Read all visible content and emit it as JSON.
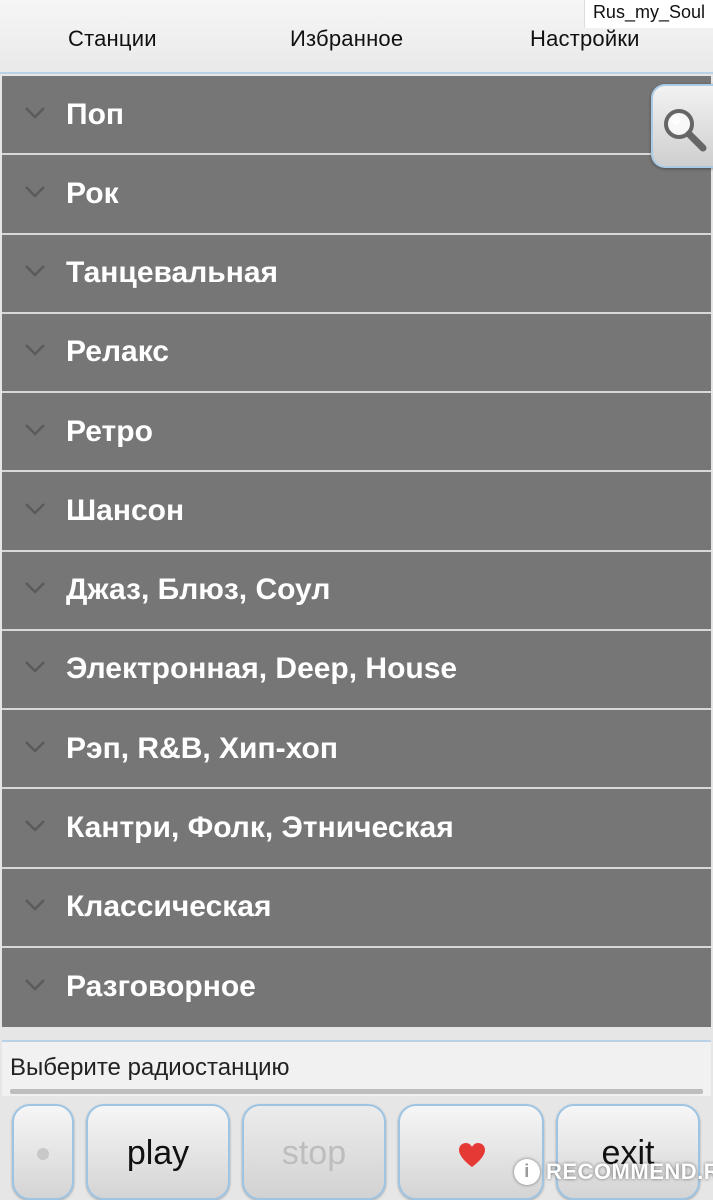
{
  "watermark": "Rus_my_Soul",
  "tabs": [
    {
      "label": "Станции"
    },
    {
      "label": "Избранное"
    },
    {
      "label": "Настройки"
    }
  ],
  "categories": [
    {
      "label": "Поп"
    },
    {
      "label": "Рок"
    },
    {
      "label": "Танцевальная"
    },
    {
      "label": "Релакс"
    },
    {
      "label": "Ретро"
    },
    {
      "label": "Шансон"
    },
    {
      "label": "Джаз, Блюз, Соул"
    },
    {
      "label": "Электронная, Deep, House"
    },
    {
      "label": "Рэп, R&B, Хип-хоп"
    },
    {
      "label": "Кантри, Фолк, Этническая"
    },
    {
      "label": "Классическая"
    },
    {
      "label": "Разговорное"
    }
  ],
  "search": {
    "icon": "search-icon"
  },
  "status": {
    "text": "Выберите радиостанцию"
  },
  "controls": {
    "play_label": "play",
    "stop_label": "stop",
    "exit_label": "exit",
    "favorite_icon": "heart-icon",
    "heart_color": "#e53935"
  },
  "recommend_badge": {
    "icon_text": "i",
    "text": "RECOMMEND.RU"
  },
  "colors": {
    "row_bg": "#767676",
    "accent_border": "#9ec4e4",
    "label": "#ffffff"
  }
}
